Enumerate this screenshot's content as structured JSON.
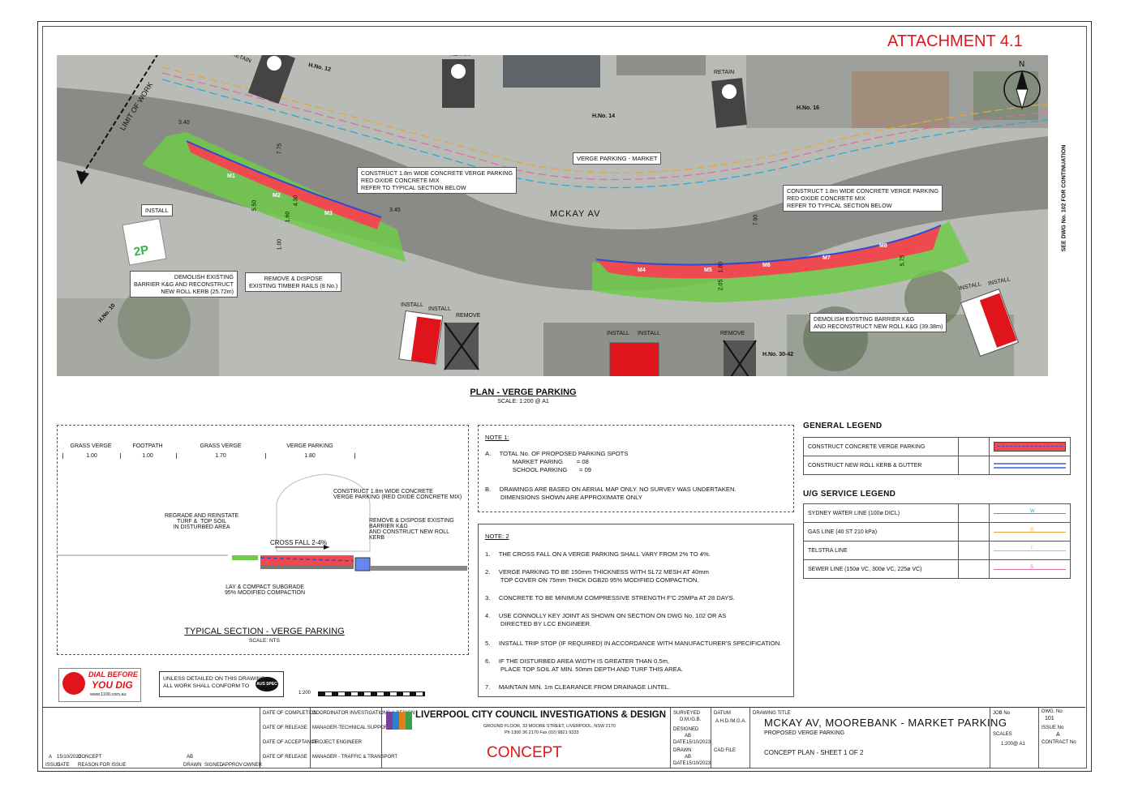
{
  "attachment": "ATTACHMENT 4.1",
  "plan": {
    "title": "PLAN - VERGE PARKING",
    "scale": "SCALE: 1:200 @ A1",
    "street": "MCKAY AV",
    "limit_of_work": "LIMIT OF WORK",
    "continuation": "SEE DWG No. 102 FOR CONTINUATION",
    "houses": [
      "H.No. 12",
      "H.No. 14",
      "H.No. 16",
      "H.No. 10",
      "H.No. 30-42"
    ],
    "retain": "RETAIN",
    "verge_market": "VERGE PARKING - MARKET",
    "callout_construct": "CONSTRUCT 1.8m WIDE CONCRETE VERGE PARKING\nRED OXIDE CONCRETE MIX\nREFER TO TYPICAL SECTION BELOW",
    "callout_demolish_left": "DEMOLISH EXISTING\nBARRIER K&G AND RECONSTRUCT\nNEW ROLL KERB (25.72m)",
    "callout_remove": "REMOVE & DISPOSE\nEXISTING TIMBER RAILS (8 No.)",
    "callout_demolish_right": "DEMOLISH EXISTING BARRIER K&G\nAND RECONSTRUCT NEW ROLL K&G (39.38m)",
    "install": "INSTALL",
    "remove": "REMOVE",
    "bays": [
      "M1",
      "M2",
      "M3",
      "M4",
      "M5",
      "M6",
      "M7",
      "M8"
    ],
    "dims": [
      "3.40",
      "7.75",
      "5.50",
      "4.30",
      "3.45",
      "1.60",
      "1.00",
      "7.90",
      "1.80",
      "2.05",
      "5.75"
    ],
    "sign_2p": "2P"
  },
  "section": {
    "title": "TYPICAL SECTION - VERGE PARKING",
    "scale": "SCALE: NTS",
    "cols": [
      {
        "name": "GRASS VERGE",
        "width": "1.00"
      },
      {
        "name": "FOOTPATH",
        "width": "1.00"
      },
      {
        "name": "GRASS VERGE",
        "width": "1.70"
      },
      {
        "name": "VERGE PARKING",
        "width": "1.80"
      }
    ],
    "construct": "CONSTRUCT 1.8m WIDE CONCRETE\nVERGE PARKING (RED OXIDE CONCRETE MIX)",
    "regrade": "REGRADE AND REINSTATE\nTURF &  TOP SOIL\nIN DISTURBED AREA",
    "remove": "REMOVE & DISPOSE EXISTING\nBARRIER K&G\nAND CONSTRUCT NEW ROLL\nKERB",
    "crossfall": "CROSS FALL 2-4%",
    "subgrade": "LAY & COMPACT SUBGRADE\n95% MODIFIED COMPACTION"
  },
  "note1": {
    "title": "NOTE 1:",
    "a": "A.     TOTAL No. OF PROPOSED PARKING SPOTS\n                MARKET PARING        = 08\n                SCHOOL PARKING       = 09",
    "b": "B.     DRAWINGS ARE BASED ON AERIAL MAP ONLY. NO SURVEY WAS UNDERTAKEN.\n         DIMENSIONS SHOWN ARE APPROXIMATE ONLY"
  },
  "note2": {
    "title": "NOTE: 2",
    "items": [
      "1.     THE CROSS FALL ON A VERGE PARKING SHALL VARY FROM 2% TO 4%.",
      "2.     VERGE PARKING TO BE 150mm THICKNESS WITH SL72 MESH AT 40mm\n         TOP COVER ON 75mm THICK DGB20 95% MODIFIED COMPACTION.",
      "3.     CONCRETE TO BE MINIMUM COMPRESSIVE STRENGTH F'C 25MPa AT 28 DAYS.",
      "4.     USE CONNOLLY KEY JOINT AS SHOWN ON SECTION ON DWG No. 102 OR AS\n         DIRECTED BY LCC ENGINEER.",
      "5.     INSTALL TRIP STOP (IF REQUIRED) IN ACCORDANCE WITH MANUFACTURER'S SPECIFICATION.",
      "6.     IF THE DISTURBED AREA WIDTH IS GREATER THAN 0.5m,\n         PLACE TOP SOIL AT MIN. 50mm DEPTH AND TURF THIS AREA.",
      "7.     MAINTAIN MIN. 1m CLEARANCE FROM DRAINAGE LINTEL."
    ]
  },
  "legend": {
    "general_title": "GENERAL LEGEND",
    "general": [
      "CONSTRUCT CONCRETE VERGE PARKING",
      "CONSTRUCT NEW ROLL KERB & GUTTER"
    ],
    "ug_title": "U/G SERVICE LEGEND",
    "ug": [
      {
        "label": "SYDNEY WATER LINE (100ø DICL)",
        "code": "W",
        "color": "#2aa7d8"
      },
      {
        "label": "GAS LINE (40 ST 210 kPa)",
        "code": "G",
        "color": "#e8a33a"
      },
      {
        "label": "TELSTRA LINE",
        "code": "T",
        "color": "#e6c229"
      },
      {
        "label": "SEWER LINE (150ø VC, 300ø VC, 225ø VC)",
        "code": "S",
        "color": "#e06aa0"
      }
    ]
  },
  "dbyd": {
    "line1": "DIAL BEFORE",
    "line2": "YOU DIG",
    "url": "www.1100.com.au"
  },
  "unless": "UNLESS DETAILED ON THIS DRAWING\nALL WORK SHALL CONFORM TO",
  "aus_spec": "AUS SPEC",
  "scale_bar": "1:200",
  "title_block": {
    "council": "LIVERPOOL CITY COUNCIL INVESTIGATIONS & DESIGN",
    "address": "GROUND FLOOR, 33 MOORE STREET, LIVERPOOL, NSW 2170",
    "phone": "Ph 1300 36 2170    Fax (02) 9821 9333",
    "concept": "CONCEPT",
    "drawing_title_label": "DRAWING TITLE",
    "drawing_title": "MCKAY AV, MOOREBANK - MARKET PARKING",
    "sub1": "PROPOSED VERGE PARKING",
    "sub2": "CONCEPT PLAN - SHEET 1 OF 2",
    "dwg_no_label": "DWG. No",
    "dwg_no": "101",
    "issue_label": "ISSUE No",
    "issue": "A",
    "scale_label": "SCALES",
    "scale": "1:200@ A1",
    "job_label": "JOB No",
    "contract_label": "CONTRACT No",
    "surveyed_label": "SURVEYED",
    "surveyed": "D.M./G.B.",
    "datum_label": "DATUM",
    "datum": "A.H.D./M.G.A.",
    "designed_label": "DESIGNED",
    "designed": "AB",
    "drawn_label": "DRAWN",
    "drawn": "AB",
    "date_label": "DATE",
    "date": "15/10/2023",
    "cad_label": "CAD FILE",
    "rows": [
      "DATE OF COMPLETION",
      "DATE OF RELEASE",
      "DATE OF ACCEPTANCE",
      "DATE OF RELEASE"
    ],
    "roles": [
      "COORDINATOR INVESTIGATIONS & DESIGN",
      "MANAGER-TECHNICAL SUPPORT",
      "PROJECT ENGINEER",
      "MANAGER - TRAFFIC & TRANSPORT"
    ],
    "rev_headers": [
      "ISSUE",
      "DATE",
      "REASON FOR ISSUE",
      "DRAWN",
      "SIGNED",
      "APPROV",
      "OWNER"
    ],
    "rev_row": {
      "issue": "A",
      "date": "15/10/2023",
      "reason": "CONCEPT",
      "drawn": "AB"
    }
  }
}
